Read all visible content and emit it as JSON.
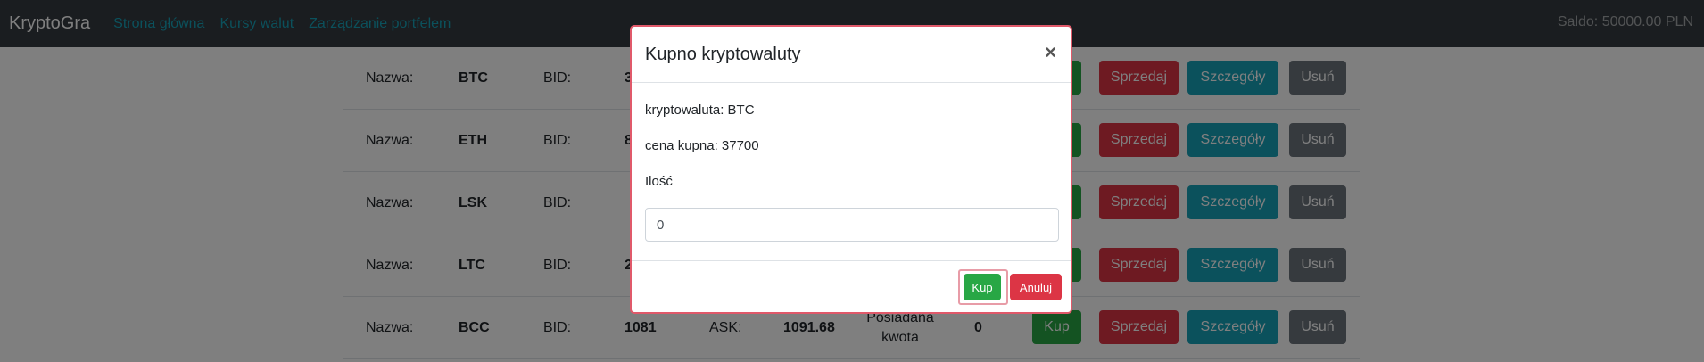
{
  "navbar": {
    "brand": "KryptoGra",
    "links": [
      "Strona główna",
      "Kursy walut",
      "Zarządzanie portfelem"
    ],
    "saldo": "Saldo: 50000.00 PLN"
  },
  "rows": [
    {
      "name_label": "Nazwa:",
      "name": "BTC",
      "bid_label": "BID:",
      "bid": "3",
      "ask_label": "",
      "ask": "",
      "owned_label": "",
      "owned": ""
    },
    {
      "name_label": "Nazwa:",
      "name": "ETH",
      "bid_label": "BID:",
      "bid": "8",
      "ask_label": "",
      "ask": "",
      "owned_label": "",
      "owned": ""
    },
    {
      "name_label": "Nazwa:",
      "name": "LSK",
      "bid_label": "BID:",
      "bid": "",
      "ask_label": "",
      "ask": "",
      "owned_label": "",
      "owned": ""
    },
    {
      "name_label": "Nazwa:",
      "name": "LTC",
      "bid_label": "BID:",
      "bid": "2",
      "ask_label": "",
      "ask": "",
      "owned_label": "",
      "owned": ""
    },
    {
      "name_label": "Nazwa:",
      "name": "BCC",
      "bid_label": "BID:",
      "bid": "1081",
      "ask_label": "ASK:",
      "ask": "1091.68",
      "owned_label": "Posiadana kwota",
      "owned": "0"
    }
  ],
  "row_buttons": {
    "buy": "Kup",
    "sell": "Sprzedaj",
    "details": "Szczegóły",
    "delete": "Usuń"
  },
  "modal": {
    "title": "Kupno kryptowaluty",
    "close": "×",
    "crypto_line": "kryptowaluta: BTC",
    "price_line": "cena kupna: 37700",
    "qty_label": "Ilość",
    "qty_value": "0",
    "buy_button": "Kup",
    "cancel_button": "Anuluj"
  },
  "colors": {
    "success": "#28a745",
    "danger": "#dc3545",
    "info": "#17a2b8",
    "secondary": "#6c757d",
    "navbar": "#343a40"
  }
}
